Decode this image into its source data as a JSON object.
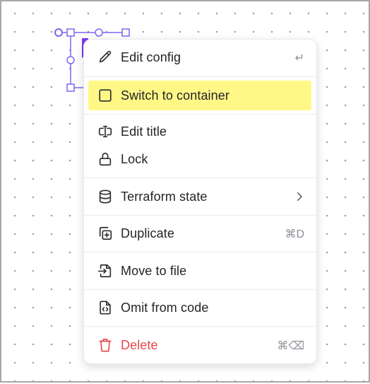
{
  "menu": {
    "items": [
      {
        "label": "Edit config",
        "icon": "pencil-icon",
        "shortcut": "↵"
      },
      {
        "label": "Switch to container",
        "icon": "square-icon",
        "highlighted": true
      },
      {
        "label": "Edit title",
        "icon": "text-cursor-input-icon"
      },
      {
        "label": "Lock",
        "icon": "lock-icon"
      },
      {
        "label": "Terraform state",
        "icon": "database-icon",
        "submenu": true
      },
      {
        "label": "Duplicate",
        "icon": "copy-plus-icon",
        "shortcut": "⌘D"
      },
      {
        "label": "Move to file",
        "icon": "file-export-icon"
      },
      {
        "label": "Omit from code",
        "icon": "file-code-icon"
      },
      {
        "label": "Delete",
        "icon": "trash-icon",
        "shortcut": "⌘⌫",
        "danger": true
      }
    ]
  },
  "colors": {
    "highlight": "#fff887",
    "danger": "#e5484d",
    "selection": "#7b68ee",
    "node_accent": "#7c3aed"
  }
}
